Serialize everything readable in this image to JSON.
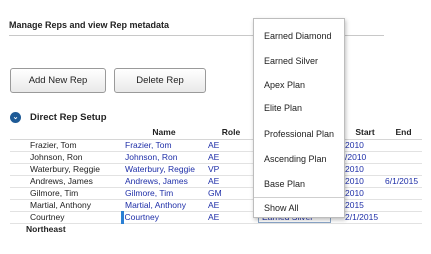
{
  "header": {
    "title": "Manage Reps and view Rep metadata"
  },
  "toolbar": {
    "add_label": "Add New Rep",
    "delete_label": "Delete Rep"
  },
  "section": {
    "title": "Direct Rep Setup",
    "icon": "chevron-down-icon"
  },
  "table": {
    "columns": [
      "",
      "Name",
      "Role",
      "",
      "Start",
      "End"
    ],
    "rows": [
      {
        "rep": "Frazier, Tom",
        "name": "Frazier, Tom",
        "role": "AE",
        "plan": "",
        "start": "2010",
        "end": ""
      },
      {
        "rep": "Johnson, Ron",
        "name": "Johnson, Ron",
        "role": "AE",
        "plan": "",
        "start": "/2010",
        "end": ""
      },
      {
        "rep": "Waterbury, Reggie",
        "name": "Waterbury, Reggie",
        "role": "VP",
        "plan": "",
        "start": "2010",
        "end": ""
      },
      {
        "rep": "Andrews, James",
        "name": "Andrews, James",
        "role": "AE",
        "plan": "",
        "start": "2010",
        "end": "6/1/2015"
      },
      {
        "rep": "Gilmore, Tim",
        "name": "Gilmore, Tim",
        "role": "GM",
        "plan": "",
        "start": "2010",
        "end": ""
      },
      {
        "rep": "Martial, Anthony",
        "name": "Martial, Anthony",
        "role": "AE",
        "plan": "",
        "start": "2015",
        "end": ""
      },
      {
        "rep": "Courtney",
        "name": "Courtney",
        "role": "AE",
        "plan": "Earned Silver",
        "start": "2/1/2015",
        "end": ""
      }
    ],
    "group": "Northeast"
  },
  "dropdown": {
    "options": [
      "Earned Diamond",
      "Earned Silver",
      "Apex Plan",
      "Elite Plan",
      "Professional Plan",
      "Ascending Plan",
      "Base Plan",
      "Show All"
    ],
    "selected": "Earned Silver"
  },
  "colors": {
    "link": "#1f2fa8",
    "accent": "#1e5a96",
    "edit_marker": "#2a7fd4"
  }
}
